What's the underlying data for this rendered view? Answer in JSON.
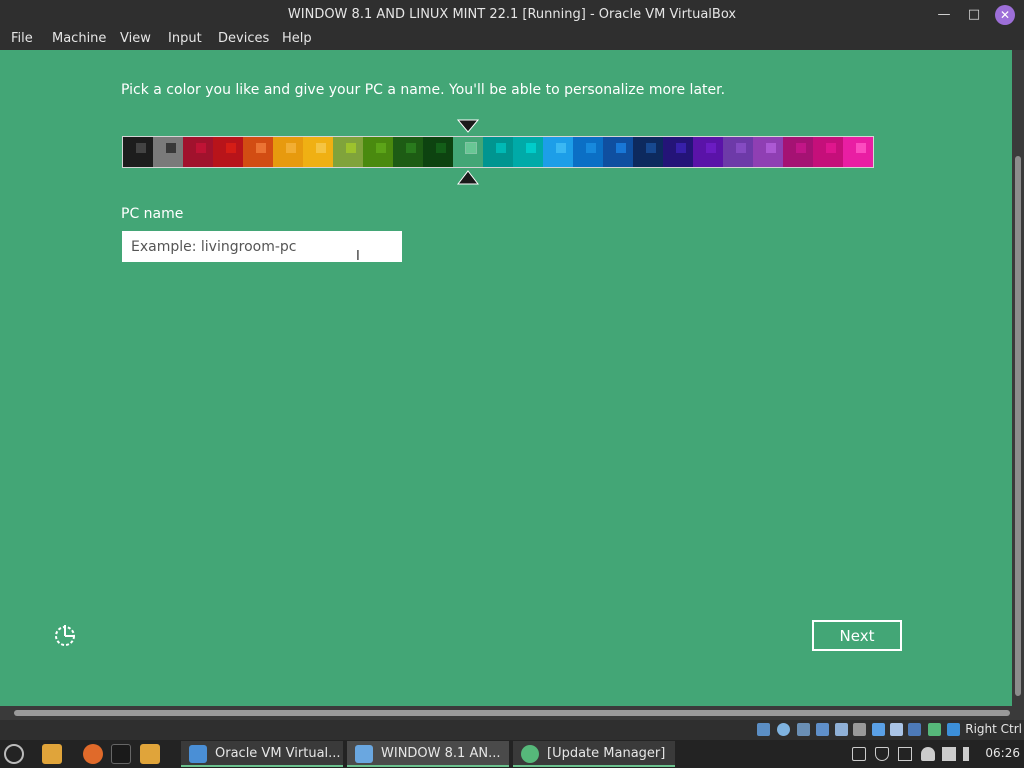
{
  "window": {
    "title": "WINDOW 8.1 AND LINUX MINT 22.1 [Running] - Oracle VM VirtualBox",
    "minimize_icon": "minimize-icon",
    "maximize_icon": "maximize-icon",
    "close_icon": "close-icon"
  },
  "menubar": {
    "items": [
      "File",
      "Machine",
      "View",
      "Input",
      "Devices",
      "Help"
    ]
  },
  "setup": {
    "instruction": "Pick a color you like and give your PC a name. You'll be able to personalize more later.",
    "pc_name_label": "PC name",
    "pc_name_placeholder": "Example: livingroom-pc",
    "pc_name_value": "",
    "next_label": "Next",
    "selected_color_index": 11,
    "palette": [
      {
        "bg": "#1d1d1d",
        "accent": "#4a4a4a"
      },
      {
        "bg": "#7a7a7a",
        "accent": "#2d2d2d"
      },
      {
        "bg": "#a1122d",
        "accent": "#c41437"
      },
      {
        "bg": "#b8141a",
        "accent": "#d91f16"
      },
      {
        "bg": "#d24d13",
        "accent": "#f07a3a"
      },
      {
        "bg": "#e79a0e",
        "accent": "#f3b23a"
      },
      {
        "bg": "#f0b013",
        "accent": "#f6c84b"
      },
      {
        "bg": "#80a33b",
        "accent": "#a2c82c"
      },
      {
        "bg": "#4a8a0f",
        "accent": "#5fa81a"
      },
      {
        "bg": "#1d5c14",
        "accent": "#2b7f1e"
      },
      {
        "bg": "#0d4310",
        "accent": "#15631a"
      },
      {
        "bg": "#43a676",
        "accent": "#6fcc9a"
      },
      {
        "bg": "#009590",
        "accent": "#00c0bc"
      },
      {
        "bg": "#00aaa8",
        "accent": "#00d2d0"
      },
      {
        "bg": "#1d9ee8",
        "accent": "#3fbcf5"
      },
      {
        "bg": "#0b6fc5",
        "accent": "#1a8ee0"
      },
      {
        "bg": "#0f4fa0",
        "accent": "#1a7ee0"
      },
      {
        "bg": "#0d2a5e",
        "accent": "#1a4f99"
      },
      {
        "bg": "#241478",
        "accent": "#3b22b3"
      },
      {
        "bg": "#5a13a8",
        "accent": "#6e1fc7"
      },
      {
        "bg": "#6d3aa8",
        "accent": "#8a4fc7"
      },
      {
        "bg": "#8f3fb3",
        "accent": "#b25ed9"
      },
      {
        "bg": "#a51273",
        "accent": "#c6188b"
      },
      {
        "bg": "#c50f7a",
        "accent": "#e31890"
      },
      {
        "bg": "#e91ea3",
        "accent": "#ff53c4"
      }
    ]
  },
  "statusbar": {
    "host_key": "Right Ctrl"
  },
  "taskbar": {
    "windows": [
      {
        "label": "Oracle VM Virtual..."
      },
      {
        "label": "WINDOW 8.1 AN..."
      },
      {
        "label": "[Update Manager]"
      }
    ],
    "clock": "06:26"
  },
  "colors": {
    "vm_background": "#43a676",
    "title_bar": "#2f2f2f",
    "taskbar": "#232323"
  }
}
